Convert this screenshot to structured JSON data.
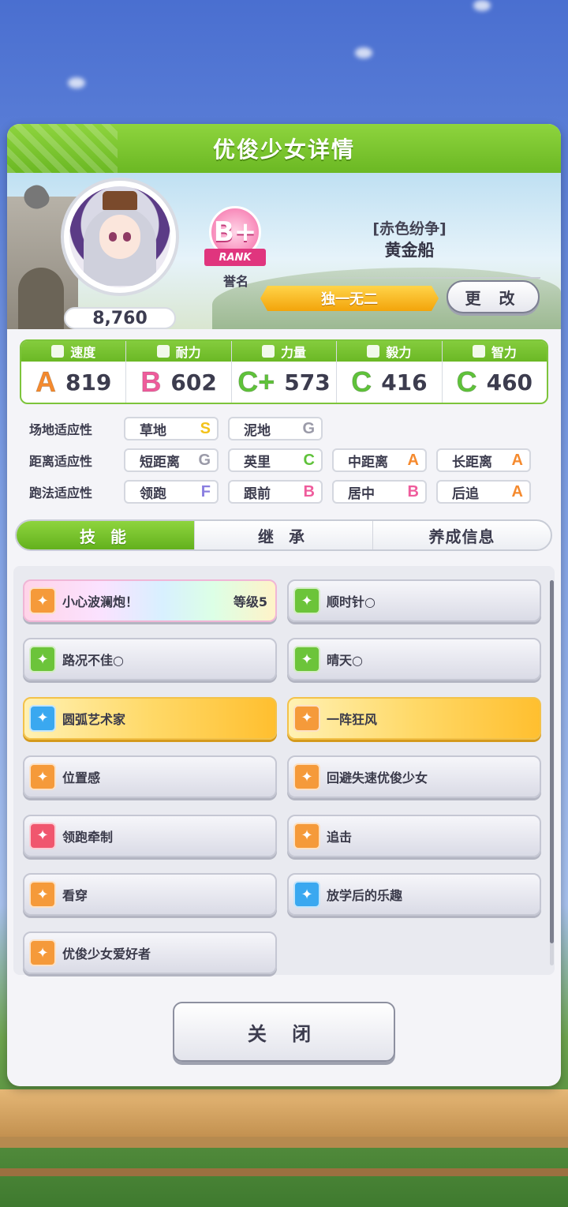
{
  "header": {
    "title": "优俊少女详情"
  },
  "character": {
    "score": "8,760",
    "rank": {
      "grade": "B+",
      "ribbon": "RANK",
      "label": "誉名"
    },
    "epithet": "[赤色纷争]",
    "name": "黄金船",
    "title_banner": "独一无二",
    "change_button": "更 改"
  },
  "stats": [
    {
      "icon": "shoe-icon",
      "label": "速度",
      "grade": "A",
      "color": "#f58a2e",
      "value": "819"
    },
    {
      "icon": "heart-icon",
      "label": "耐力",
      "grade": "B",
      "color": "#ef5c9c",
      "value": "602"
    },
    {
      "icon": "muscle-icon",
      "label": "力量",
      "grade": "C+",
      "color": "#5fc23a",
      "value": "573"
    },
    {
      "icon": "flame-icon",
      "label": "毅力",
      "grade": "C",
      "color": "#5fc23a",
      "value": "416"
    },
    {
      "icon": "graduation-cap-icon",
      "label": "智力",
      "grade": "C",
      "color": "#5fc23a",
      "value": "460"
    }
  ],
  "aptitude": {
    "track": {
      "label": "场地适应性",
      "items": [
        {
          "name": "草地",
          "grade": "S",
          "color": "#f3c21a"
        },
        {
          "name": "泥地",
          "grade": "G",
          "color": "#9a9aa8"
        }
      ]
    },
    "distance": {
      "label": "距离适应性",
      "items": [
        {
          "name": "短距离",
          "grade": "G",
          "color": "#9a9aa8"
        },
        {
          "name": "英里",
          "grade": "C",
          "color": "#5fc23a"
        },
        {
          "name": "中距离",
          "grade": "A",
          "color": "#f58a2e"
        },
        {
          "name": "长距离",
          "grade": "A",
          "color": "#f58a2e"
        }
      ]
    },
    "strategy": {
      "label": "跑法适应性",
      "items": [
        {
          "name": "领跑",
          "grade": "F",
          "color": "#8a7ee0"
        },
        {
          "name": "跟前",
          "grade": "B",
          "color": "#ef5c9c"
        },
        {
          "name": "居中",
          "grade": "B",
          "color": "#ef5c9c"
        },
        {
          "name": "后追",
          "grade": "A",
          "color": "#f58a2e"
        }
      ]
    }
  },
  "tabs": [
    {
      "label": "技 能",
      "active": true
    },
    {
      "label": "继 承",
      "active": false
    },
    {
      "label": "养成信息",
      "active": false
    }
  ],
  "skills": [
    {
      "name": "小心波澜炮！",
      "level": "等级5",
      "style": "rainbow",
      "icon_color": "#f59a3a"
    },
    {
      "name": "顺时针○",
      "level": "",
      "style": "normal",
      "icon_color": "#6cc43a"
    },
    {
      "name": "路况不佳○",
      "level": "",
      "style": "normal",
      "icon_color": "#6cc43a"
    },
    {
      "name": "晴天○",
      "level": "",
      "style": "normal",
      "icon_color": "#6cc43a"
    },
    {
      "name": "圆弧艺术家",
      "level": "",
      "style": "gold",
      "icon_color": "#3aa8f0"
    },
    {
      "name": "一阵狂风",
      "level": "",
      "style": "gold",
      "icon_color": "#f59a3a"
    },
    {
      "name": "位置感",
      "level": "",
      "style": "normal",
      "icon_color": "#f59a3a"
    },
    {
      "name": "回避失速优俊少女",
      "level": "",
      "style": "normal",
      "icon_color": "#f59a3a"
    },
    {
      "name": "领跑牵制",
      "level": "",
      "style": "normal",
      "icon_color": "#f0566e"
    },
    {
      "name": "追击",
      "level": "",
      "style": "normal",
      "icon_color": "#f59a3a"
    },
    {
      "name": "看穿",
      "level": "",
      "style": "normal",
      "icon_color": "#f59a3a"
    },
    {
      "name": "放学后的乐趣",
      "level": "",
      "style": "normal",
      "icon_color": "#3aa8f0"
    },
    {
      "name": "优俊少女爱好者",
      "level": "",
      "style": "normal",
      "icon_color": "#f59a3a"
    }
  ],
  "close_button": "关 闭"
}
